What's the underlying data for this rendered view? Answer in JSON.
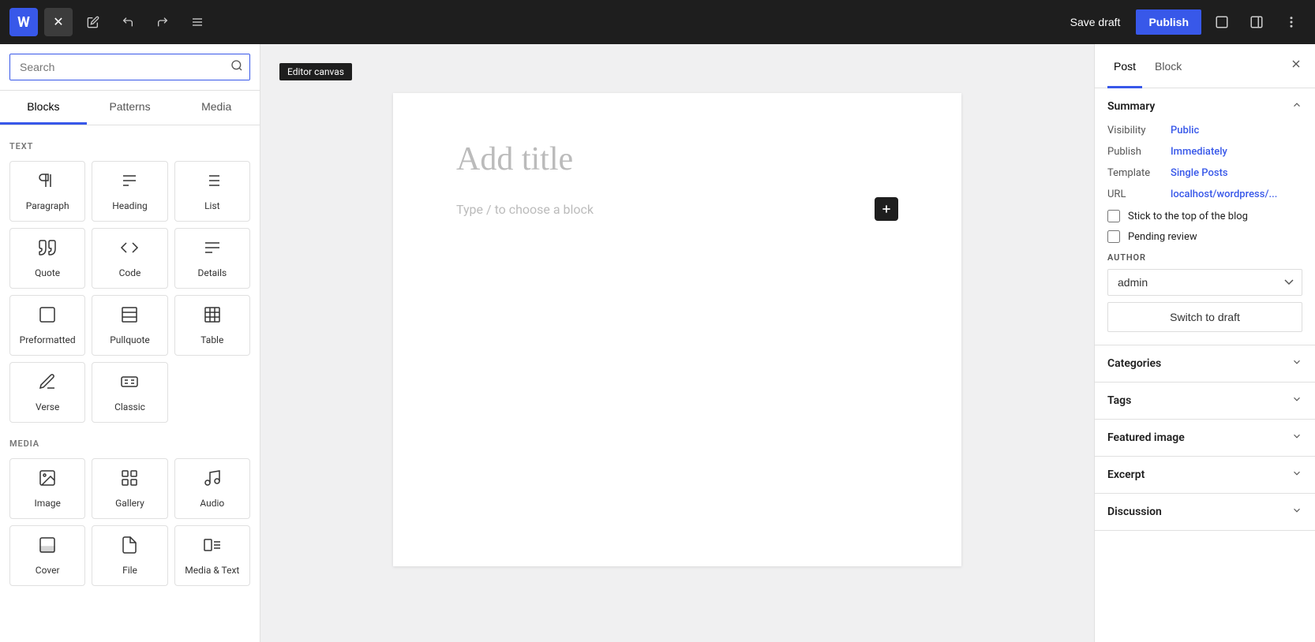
{
  "topbar": {
    "logo_letter": "W",
    "close_label": "✕",
    "edit_icon": "✎",
    "undo_icon": "↩",
    "redo_icon": "↪",
    "tools_icon": "≡",
    "save_draft_label": "Save draft",
    "publish_label": "Publish",
    "view_icon": "⬜",
    "sidebar_icon": "▣",
    "more_icon": "⋮"
  },
  "left_sidebar": {
    "search_placeholder": "Search",
    "tabs": [
      "Blocks",
      "Patterns",
      "Media"
    ],
    "active_tab": "Blocks",
    "section_text": {
      "text_label": "TEXT",
      "media_label": "MEDIA"
    },
    "text_blocks": [
      {
        "id": "paragraph",
        "label": "Paragraph",
        "icon": "¶"
      },
      {
        "id": "heading",
        "label": "Heading",
        "icon": "H"
      },
      {
        "id": "list",
        "label": "List",
        "icon": "≡"
      },
      {
        "id": "quote",
        "label": "Quote",
        "icon": "❝"
      },
      {
        "id": "code",
        "label": "Code",
        "icon": "<>"
      },
      {
        "id": "details",
        "label": "Details",
        "icon": "≡"
      },
      {
        "id": "preformatted",
        "label": "Preformatted",
        "icon": "⬜"
      },
      {
        "id": "pullquote",
        "label": "Pullquote",
        "icon": "⬜"
      },
      {
        "id": "table",
        "label": "Table",
        "icon": "⊞"
      },
      {
        "id": "verse",
        "label": "Verse",
        "icon": "✍"
      },
      {
        "id": "classic",
        "label": "Classic",
        "icon": "⌨"
      }
    ],
    "media_blocks": [
      {
        "id": "image",
        "label": "Image",
        "icon": "🖼"
      },
      {
        "id": "gallery",
        "label": "Gallery",
        "icon": "⊞"
      },
      {
        "id": "audio",
        "label": "Audio",
        "icon": "♪"
      },
      {
        "id": "cover",
        "label": "Cover",
        "icon": "⬜"
      },
      {
        "id": "file",
        "label": "File",
        "icon": "📁"
      },
      {
        "id": "media-text",
        "label": "Media & Text",
        "icon": "≡"
      }
    ]
  },
  "editor": {
    "canvas_label": "Editor canvas",
    "title_placeholder": "Add title",
    "body_placeholder": "Type / to choose a block"
  },
  "right_sidebar": {
    "tabs": [
      "Post",
      "Block"
    ],
    "active_tab": "Post",
    "close_icon": "✕",
    "summary": {
      "label": "Summary",
      "visibility_label": "Visibility",
      "visibility_value": "Public",
      "publish_label": "Publish",
      "publish_value": "Immediately",
      "template_label": "Template",
      "template_value": "Single Posts",
      "url_label": "URL",
      "url_value": "localhost/wordpress/...",
      "stick_to_top_label": "Stick to the top of the blog",
      "pending_review_label": "Pending review"
    },
    "author": {
      "label": "AUTHOR",
      "value": "admin",
      "options": [
        "admin"
      ]
    },
    "switch_to_draft_label": "Switch to draft",
    "categories_label": "Categories",
    "tags_label": "Tags",
    "featured_image_label": "Featured image",
    "excerpt_label": "Excerpt",
    "discussion_label": "Discussion"
  }
}
